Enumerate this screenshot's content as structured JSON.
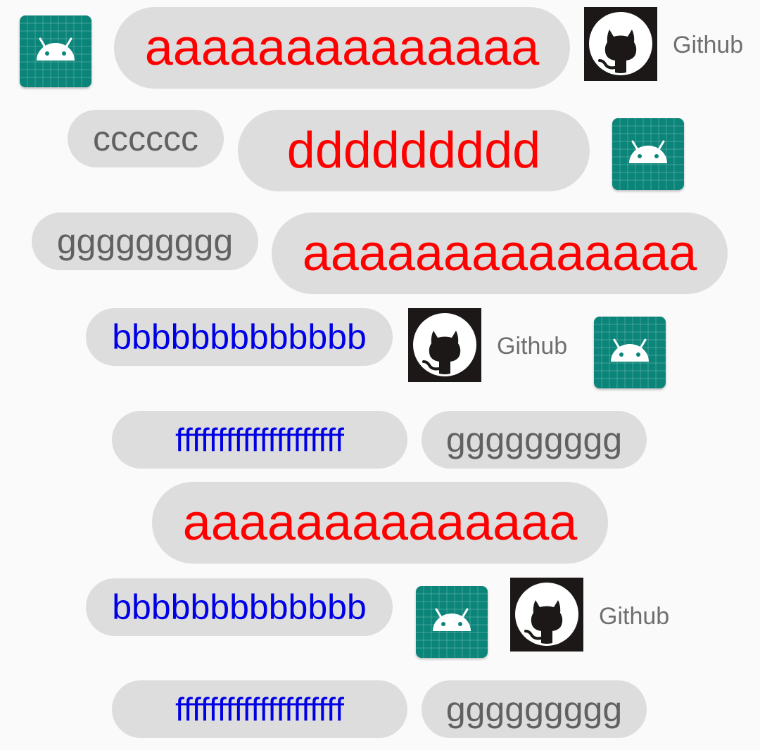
{
  "colors": {
    "background": "#fafafa",
    "chip_background": "#dddddd",
    "text_red": "#ff0000",
    "text_blue": "#0000e6",
    "text_gray": "#616161",
    "android_icon_background": "#0b8579",
    "github_icon_background": "#1b1817"
  },
  "icons": {
    "android": "android-app-icon",
    "github": "github-octocat-icon"
  },
  "rows": {
    "r1": {
      "chip1": "aaaaaaaaaaaaaa",
      "github_label": "Github"
    },
    "r2": {
      "chip1": "cccccc",
      "chip2": "ddddddddd"
    },
    "r3": {
      "chip1": "ggggggggg",
      "chip2": "aaaaaaaaaaaaaa"
    },
    "r4": {
      "chip1": "bbbbbbbbbbbbb",
      "github_label": "Github"
    },
    "r5": {
      "chip1": "ffffffffffffffffffff",
      "chip2": "ggggggggg"
    },
    "r6": {
      "chip1": "aaaaaaaaaaaaaa"
    },
    "r7": {
      "chip1": "bbbbbbbbbbbbb",
      "github_label": "Github"
    },
    "r8": {
      "chip1": "ffffffffffffffffffff",
      "chip2": "ggggggggg"
    }
  }
}
